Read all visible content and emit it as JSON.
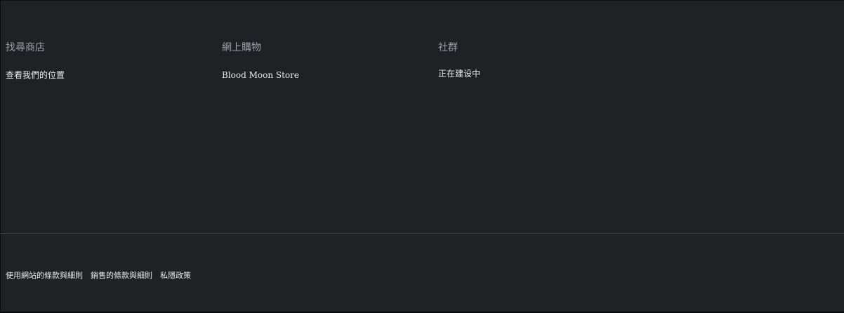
{
  "footer": {
    "columns": [
      {
        "title": "找尋商店",
        "link": "查看我們的位置"
      },
      {
        "title": "網上購物",
        "link": "Blood Moon Store"
      },
      {
        "title": "社群",
        "text": "正在建设中"
      }
    ],
    "legal_links": [
      "使用網站的條款與細則",
      "銷售的條款與細則",
      "私隱政策"
    ]
  },
  "colors": {
    "background": "#202124",
    "heading": "#9aa0a6",
    "link": "#e8eaed",
    "divider": "#3c4043"
  }
}
